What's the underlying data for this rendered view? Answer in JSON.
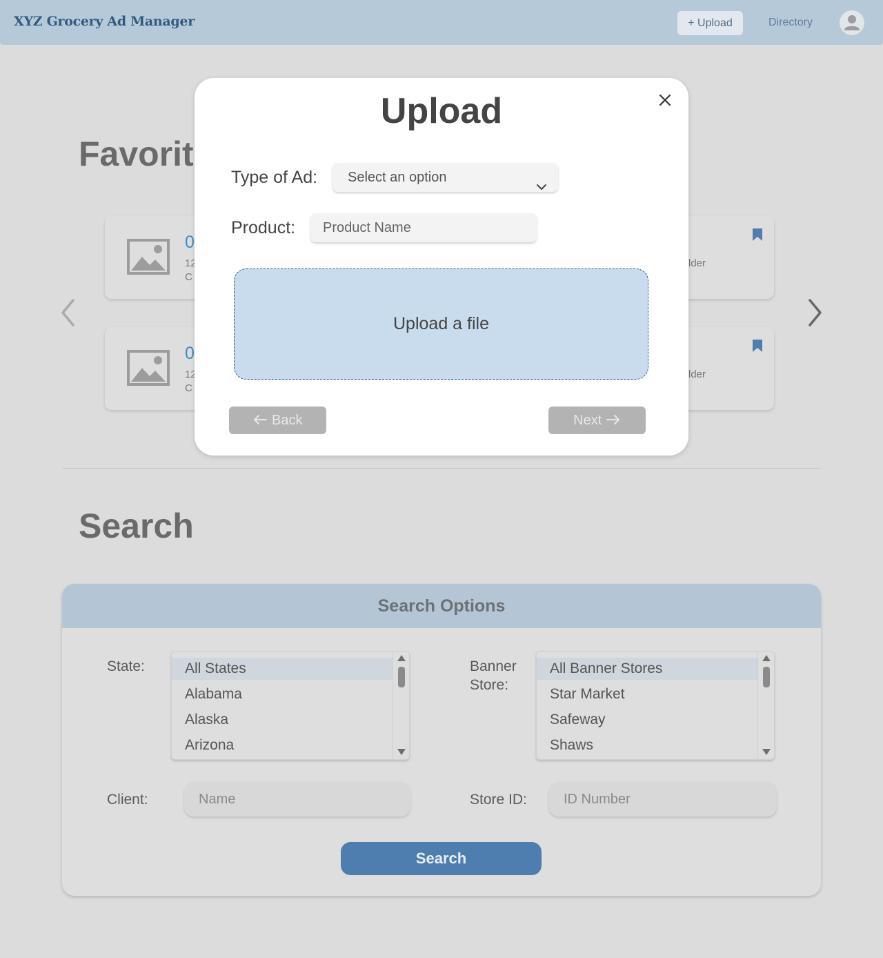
{
  "header": {
    "brand": "XYZ Grocery Ad Manager",
    "upload_label": "+ Upload",
    "directory_label": "Directory"
  },
  "favorites": {
    "title": "Favorit",
    "cards": [
      {
        "title": "0",
        "line1": "12",
        "line2": "C",
        "right": "lder"
      },
      {
        "title": "0",
        "line1": "12",
        "line2": "C",
        "right": "lder"
      }
    ]
  },
  "search": {
    "title": "Search",
    "panel_title": "Search Options",
    "state_label": "State:",
    "states": [
      "All States",
      "Alabama",
      "Alaska",
      "Arizona"
    ],
    "banner_label_1": "Banner",
    "banner_label_2": "Store:",
    "banners": [
      "All Banner Stores",
      "Star Market",
      "Safeway",
      "Shaws"
    ],
    "client_label": "Client:",
    "client_placeholder": "Name",
    "store_id_label": "Store ID:",
    "store_id_placeholder": "ID Number",
    "button_label": "Search"
  },
  "modal": {
    "title": "Upload",
    "type_label": "Type of Ad:",
    "type_value": "Select an option",
    "product_label": "Product:",
    "product_placeholder": "Product Name",
    "dropzone_label": "Upload a file",
    "back_label": "Back",
    "next_label": "Next"
  },
  "colors": {
    "header_bg": "#b6c9d8",
    "brand": "#2f5b82",
    "accent_button": "#4e7eaf",
    "dropzone_bg": "#c9dcee",
    "bookmark": "#4e7eaf"
  },
  "icons": [
    "user-avatar-icon",
    "image-placeholder-icon",
    "bookmark-icon",
    "chevron-left-icon",
    "chevron-right-icon",
    "close-icon",
    "chevron-down-icon",
    "arrow-left-icon",
    "arrow-right-icon"
  ]
}
